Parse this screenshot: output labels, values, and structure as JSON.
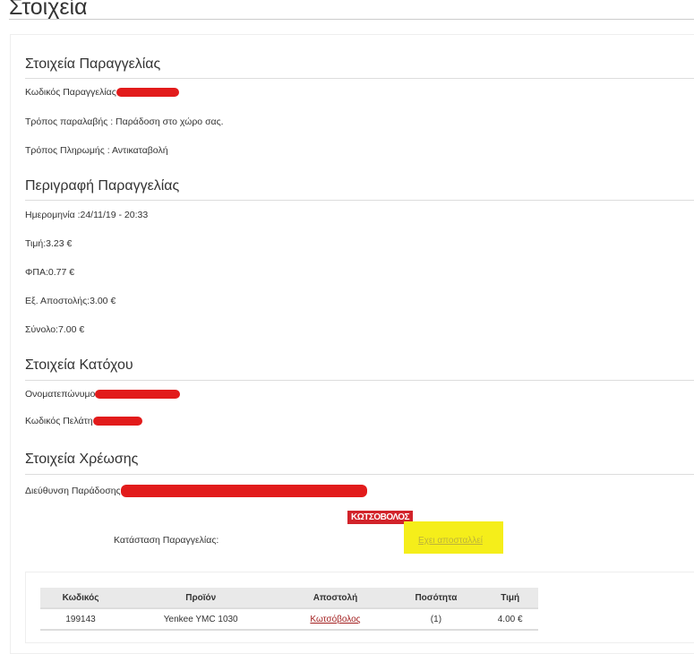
{
  "page_title": "Στοιχεία",
  "sections": [
    {
      "heading": "Στοιχεία Παραγγελίας",
      "rows": [
        "Κωδικός Παραγγελίας",
        "Τρόπος παραλαβής : Παράδοση στο χώρο σας.",
        "Τρόπος Πληρωμής : Αντικαταβολή"
      ]
    },
    {
      "heading": "Περιγραφή Παραγγελίας",
      "rows": [
        "Ημερομηνία :24/11/19 - 20:33",
        "Τιμή:3.23 €",
        "ΦΠΑ:0.77 €",
        "Εξ. Αποστολής:3.00 €",
        "Σύνολο:7.00 €"
      ]
    },
    {
      "heading": "Στοιχεία Κατόχου",
      "rows": [
        "Ονοματεπώνυμο",
        "Κωδικός Πελάτη"
      ]
    },
    {
      "heading": "Στοιχεία Χρέωσης",
      "rows": [
        "Διεύθυνση Παράδοσης"
      ]
    }
  ],
  "shipping_logo": "ΚΩΤΣΟΒΟΛΟΣ",
  "status_label": "Κατάσταση Παραγγελίας:",
  "status_value": "Εχει αποσταλλεί",
  "table": {
    "headers": [
      "Κωδικός",
      "Προϊόν",
      "Αποστολή",
      "Ποσότητα",
      "Τιμή"
    ],
    "rows": [
      [
        "199143",
        "Yenkee YMC 1030",
        "Κωτσόβολος",
        "(1)",
        "4.00 €"
      ]
    ]
  }
}
